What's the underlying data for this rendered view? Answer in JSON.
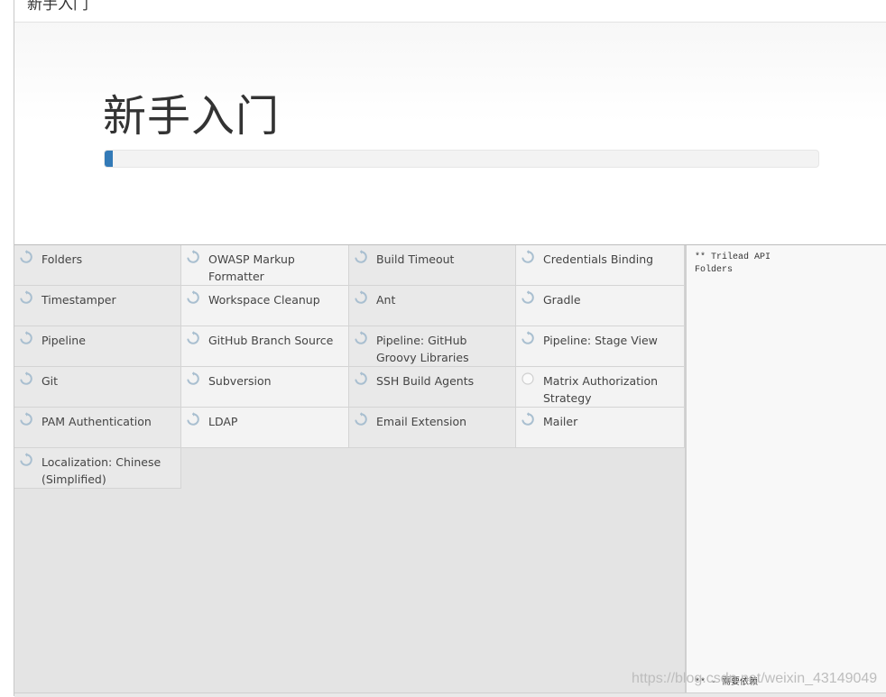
{
  "window": {
    "title": "新手入门"
  },
  "header": {
    "heading": "新手入门",
    "progress_percent": 1.2
  },
  "plugins": [
    {
      "name": "Folders",
      "status": "installing",
      "icon": "refresh-icon"
    },
    {
      "name": "OWASP Markup Formatter",
      "status": "installing",
      "icon": "refresh-icon"
    },
    {
      "name": "Build Timeout",
      "status": "installing",
      "icon": "refresh-icon"
    },
    {
      "name": "Credentials Binding",
      "status": "installing",
      "icon": "refresh-icon"
    },
    {
      "name": "Timestamper",
      "status": "installing",
      "icon": "refresh-icon"
    },
    {
      "name": "Workspace Cleanup",
      "status": "installing",
      "icon": "refresh-icon"
    },
    {
      "name": "Ant",
      "status": "installing",
      "icon": "refresh-icon"
    },
    {
      "name": "Gradle",
      "status": "installing",
      "icon": "refresh-icon"
    },
    {
      "name": "Pipeline",
      "status": "installing",
      "icon": "refresh-icon"
    },
    {
      "name": "GitHub Branch Source",
      "status": "installing",
      "icon": "refresh-icon"
    },
    {
      "name": "Pipeline: GitHub Groovy Libraries",
      "status": "installing",
      "icon": "refresh-icon"
    },
    {
      "name": "Pipeline: Stage View",
      "status": "installing",
      "icon": "refresh-icon"
    },
    {
      "name": "Git",
      "status": "installing",
      "icon": "refresh-icon"
    },
    {
      "name": "Subversion",
      "status": "installing",
      "icon": "refresh-icon"
    },
    {
      "name": "SSH Build Agents",
      "status": "installing",
      "icon": "refresh-icon"
    },
    {
      "name": "Matrix Authorization Strategy",
      "status": "pending",
      "icon": "circle-icon"
    },
    {
      "name": "PAM Authentication",
      "status": "installing",
      "icon": "refresh-icon"
    },
    {
      "name": "LDAP",
      "status": "installing",
      "icon": "refresh-icon"
    },
    {
      "name": "Email Extension",
      "status": "installing",
      "icon": "refresh-icon"
    },
    {
      "name": "Mailer",
      "status": "installing",
      "icon": "refresh-icon"
    },
    {
      "name": "Localization: Chinese (Simplified)",
      "status": "installing",
      "icon": "refresh-icon"
    }
  ],
  "log": {
    "lines": [
      "** Trilead API",
      "Folders"
    ],
    "footer": "** - 需要依赖"
  },
  "watermark": "https://blog.csdn.net/weixin_43149049",
  "colors": {
    "progress": "#337ab7",
    "icon": "#a9bfd0",
    "panel": "#e4e4e4"
  }
}
